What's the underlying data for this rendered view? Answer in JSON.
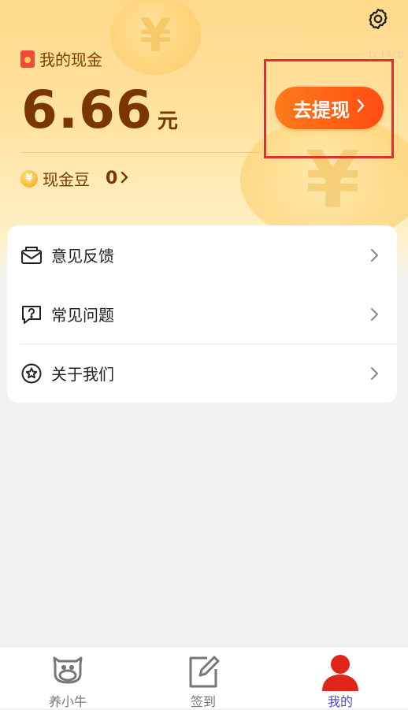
{
  "header": {
    "id_text": "1c14cb",
    "cash_title": "我的现金",
    "amount": "6.66",
    "amount_unit": "元",
    "withdraw_button": "去提现",
    "beans_icon_glyph": "¥",
    "beans_label": "现金豆",
    "beans_value": "0"
  },
  "menu": {
    "items": [
      {
        "label": "意见反馈",
        "icon": "envelope-icon"
      },
      {
        "label": "常见问题",
        "icon": "question-bubble-icon"
      },
      {
        "label": "关于我们",
        "icon": "star-circle-icon"
      }
    ]
  },
  "tabbar": {
    "tabs": [
      {
        "label": "养小牛",
        "icon": "cow-icon",
        "active": false
      },
      {
        "label": "签到",
        "icon": "sign-in-icon",
        "active": false
      },
      {
        "label": "我的",
        "icon": "profile-icon",
        "active": true
      }
    ]
  },
  "colors": {
    "accent": "#ff5a14",
    "amount_text": "#7a3600",
    "active_tab": "#4a4ad8",
    "highlight_box": "#e23030"
  }
}
